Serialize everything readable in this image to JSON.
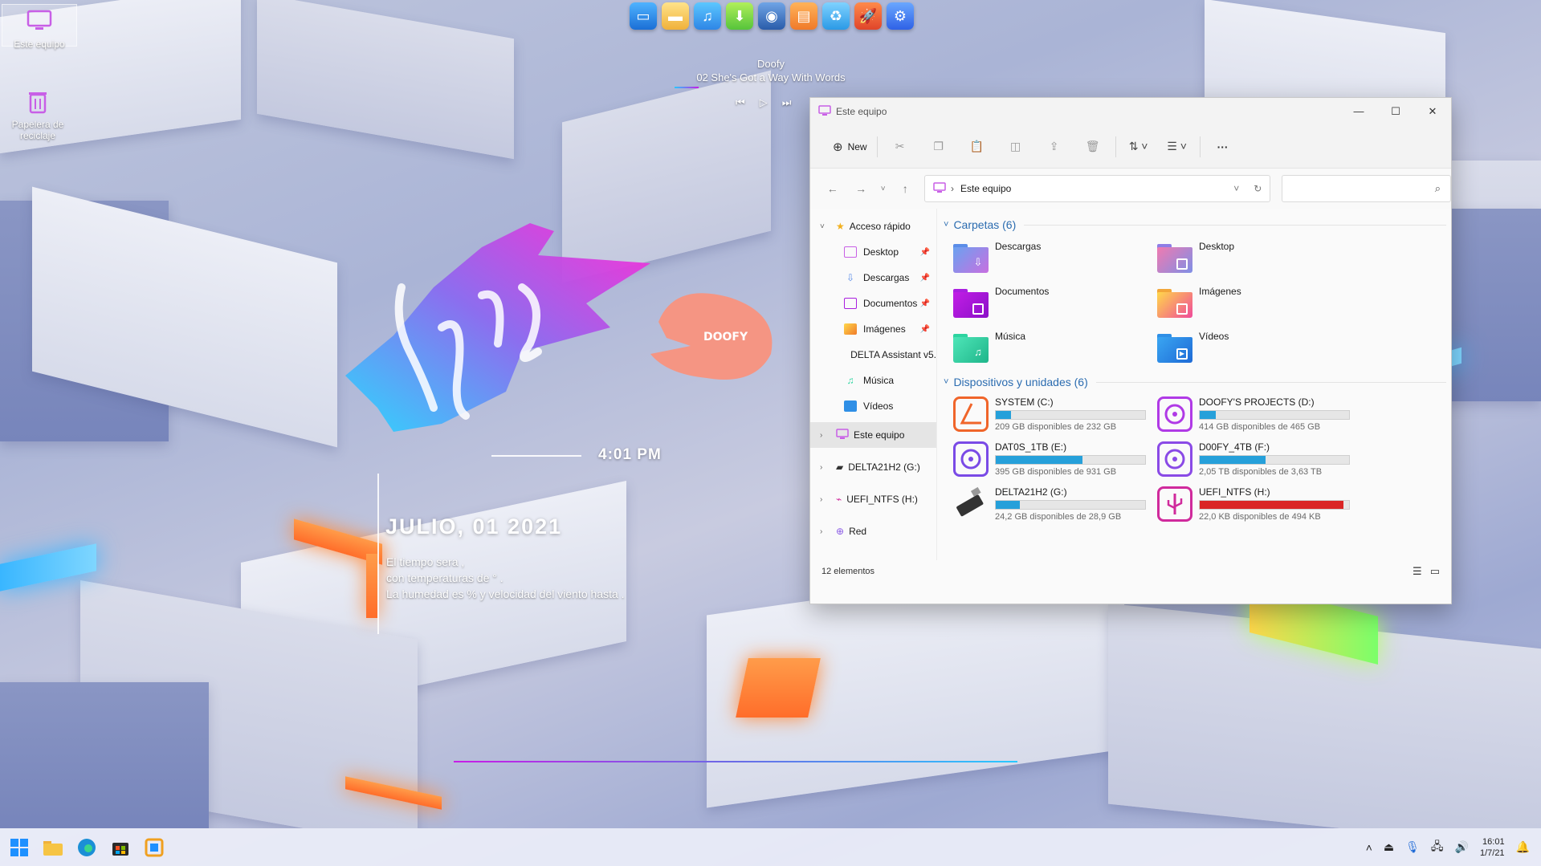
{
  "desktop": {
    "icons": [
      {
        "label": "Este equipo"
      },
      {
        "label": "Papelera de reciclaje"
      }
    ]
  },
  "dock": {
    "items": [
      "monitor-icon",
      "drive-icon",
      "music-icon",
      "download-icon",
      "camera-icon",
      "calendar-icon",
      "recycle-icon",
      "rocket-icon",
      "gear-icon"
    ]
  },
  "media": {
    "artist": "Doofy",
    "track": "02 She's Got a Way With Words"
  },
  "clock_widget": {
    "logo_text": "DOOFY",
    "time": "4:01 PM",
    "date": "JULIO, 01 2021",
    "weather_line1": "El tiempo sera ,",
    "weather_line2": "con temperaturas de ° .",
    "weather_line3": "La humedad es  % y velocidad del viento hasta  ."
  },
  "explorer": {
    "title": "Este equipo",
    "new_label": "New",
    "address": "Este equipo",
    "sidebar": {
      "quick_access": "Acceso rápido",
      "quick_items": [
        "Desktop",
        "Descargas",
        "Documentos",
        "Imágenes",
        "DELTA Assistant v5.",
        "Música",
        "Vídeos"
      ],
      "this_pc": "Este equipo",
      "drives": [
        "DELTA21H2 (G:)",
        "UEFI_NTFS (H:)"
      ],
      "network": "Red"
    },
    "folders_header": "Carpetas (6)",
    "folders": [
      {
        "name": "Descargas",
        "color": "#5b8de8"
      },
      {
        "name": "Desktop",
        "color": "#8e7de6"
      },
      {
        "name": "Documentos",
        "color": "#a91ee0"
      },
      {
        "name": "Imágenes",
        "color": "#f2a63a"
      },
      {
        "name": "Música",
        "color": "#2dd4a0"
      },
      {
        "name": "Vídeos",
        "color": "#2f8fe6"
      }
    ],
    "devices_header": "Dispositivos y unidades (6)",
    "devices": [
      {
        "name": "SYSTEM (C:)",
        "free": "209 GB disponibles de 232 GB",
        "used_fraction": 0.1,
        "full": false
      },
      {
        "name": "DOOFY'S PROJECTS (D:)",
        "free": "414 GB disponibles de 465 GB",
        "used_fraction": 0.11,
        "full": false
      },
      {
        "name": "DAT0S_1TB (E:)",
        "free": "395 GB disponibles de 931 GB",
        "used_fraction": 0.58,
        "full": false
      },
      {
        "name": "D00FY_4TB (F:)",
        "free": "2,05 TB disponibles de 3,63 TB",
        "used_fraction": 0.44,
        "full": false
      },
      {
        "name": "DELTA21H2 (G:)",
        "free": "24,2 GB disponibles de 28,9 GB",
        "used_fraction": 0.16,
        "full": false
      },
      {
        "name": "UEFI_NTFS (H:)",
        "free": "22,0 KB disponibles de 494 KB",
        "used_fraction": 0.96,
        "full": true
      }
    ],
    "status": "12 elementos"
  },
  "taskbar": {
    "time": "16:01",
    "date": "1/7/21"
  }
}
